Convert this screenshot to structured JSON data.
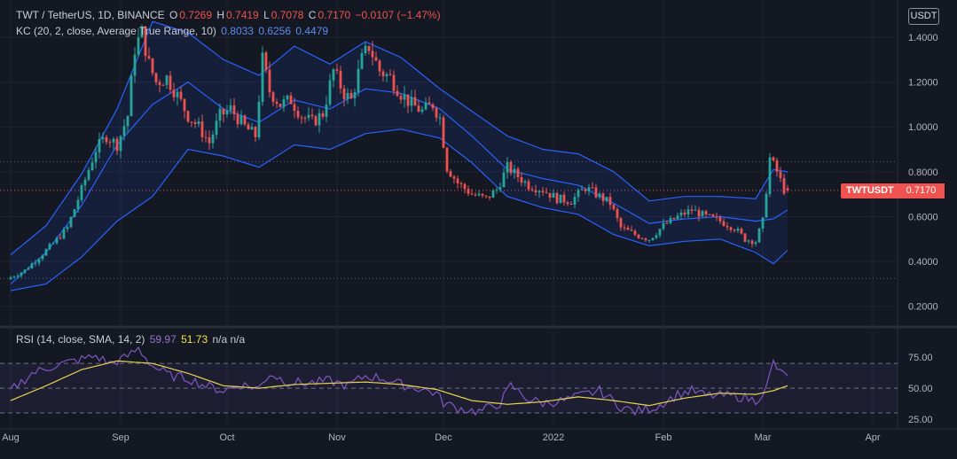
{
  "header": {
    "pair": "TWT / TetherUS, 1D, BINANCE",
    "o_label": "O",
    "o_val": "0.7269",
    "h_label": "H",
    "h_val": "0.7419",
    "l_label": "L",
    "l_val": "0.7078",
    "c_label": "C",
    "c_val": "0.7170",
    "change": "−0.0107 (−1.47%)"
  },
  "kc": {
    "label": "KC (20, 2, close, Average True Range, 10)",
    "upper": "0.8033",
    "basis": "0.6256",
    "lower": "0.4479"
  },
  "rsi": {
    "label": "RSI (14, close, SMA, 14, 2)",
    "value": "59.97",
    "sma": "51.73",
    "extra": "n/a  n/a"
  },
  "currency": "USDT",
  "symbol_tag": "TWTUSDT",
  "price_tag": "0.7170",
  "colors": {
    "up": "#26a69a",
    "down": "#ef5350",
    "band": "#2962ff",
    "rsi": "#7e57c2",
    "rsi_sma": "#e8d44d"
  },
  "chart_data": [
    {
      "type": "candlestick",
      "title": "TWT / TetherUS, 1D, BINANCE",
      "y_ticks": [
        "1.4000",
        "1.2000",
        "1.0000",
        "0.8000",
        "0.6000",
        "0.4000",
        "0.2000"
      ],
      "y_tick_values": [
        1.4,
        1.2,
        1.0,
        0.8,
        0.6,
        0.4,
        0.2
      ],
      "ylim": [
        0.12,
        1.55
      ],
      "x_ticks": [
        "Aug",
        "Sep",
        "Oct",
        "Nov",
        "Dec",
        "2022",
        "Feb",
        "Mar",
        "Apr"
      ],
      "x_tick_days": [
        0,
        31,
        61,
        92,
        122,
        153,
        184,
        212,
        243
      ],
      "x_range_days": [
        -3,
        250
      ],
      "last_price": 0.717,
      "reference_lines": [
        0.845,
        0.325
      ],
      "close_anchors": [
        [
          0,
          0.33
        ],
        [
          4,
          0.36
        ],
        [
          8,
          0.42
        ],
        [
          12,
          0.48
        ],
        [
          16,
          0.55
        ],
        [
          20,
          0.72
        ],
        [
          24,
          0.9
        ],
        [
          27,
          0.96
        ],
        [
          30,
          0.92
        ],
        [
          33,
          1.05
        ],
        [
          35,
          1.35
        ],
        [
          37,
          1.42
        ],
        [
          39,
          1.28
        ],
        [
          41,
          1.2
        ],
        [
          44,
          1.22
        ],
        [
          47,
          1.14
        ],
        [
          50,
          1.05
        ],
        [
          53,
          1.0
        ],
        [
          56,
          0.93
        ],
        [
          59,
          1.05
        ],
        [
          62,
          1.08
        ],
        [
          66,
          1.0
        ],
        [
          69,
          0.96
        ],
        [
          71,
          1.3
        ],
        [
          73,
          1.16
        ],
        [
          76,
          1.1
        ],
        [
          79,
          1.12
        ],
        [
          82,
          1.05
        ],
        [
          85,
          1.02
        ],
        [
          88,
          1.06
        ],
        [
          91,
          1.25
        ],
        [
          94,
          1.15
        ],
        [
          96,
          1.12
        ],
        [
          99,
          1.3
        ],
        [
          101,
          1.36
        ],
        [
          104,
          1.25
        ],
        [
          107,
          1.22
        ],
        [
          110,
          1.15
        ],
        [
          113,
          1.1
        ],
        [
          116,
          1.07
        ],
        [
          119,
          1.1
        ],
        [
          121,
          1.04
        ],
        [
          123,
          0.82
        ],
        [
          126,
          0.75
        ],
        [
          130,
          0.7
        ],
        [
          134,
          0.68
        ],
        [
          137,
          0.72
        ],
        [
          140,
          0.82
        ],
        [
          143,
          0.78
        ],
        [
          146,
          0.74
        ],
        [
          150,
          0.72
        ],
        [
          154,
          0.68
        ],
        [
          158,
          0.67
        ],
        [
          162,
          0.73
        ],
        [
          165,
          0.7
        ],
        [
          169,
          0.66
        ],
        [
          172,
          0.55
        ],
        [
          176,
          0.52
        ],
        [
          180,
          0.5
        ],
        [
          184,
          0.56
        ],
        [
          188,
          0.6
        ],
        [
          192,
          0.63
        ],
        [
          196,
          0.6
        ],
        [
          200,
          0.58
        ],
        [
          204,
          0.55
        ],
        [
          207,
          0.5
        ],
        [
          210,
          0.49
        ],
        [
          212,
          0.58
        ],
        [
          214,
          0.86
        ],
        [
          216,
          0.8
        ],
        [
          218,
          0.72
        ],
        [
          219,
          0.717
        ]
      ],
      "keltner_upper_anchors": [
        [
          0,
          0.43
        ],
        [
          10,
          0.56
        ],
        [
          20,
          0.79
        ],
        [
          30,
          1.08
        ],
        [
          40,
          1.47
        ],
        [
          50,
          1.42
        ],
        [
          60,
          1.3
        ],
        [
          70,
          1.23
        ],
        [
          80,
          1.36
        ],
        [
          90,
          1.28
        ],
        [
          100,
          1.38
        ],
        [
          110,
          1.31
        ],
        [
          121,
          1.17
        ],
        [
          130,
          1.07
        ],
        [
          140,
          0.96
        ],
        [
          150,
          0.9
        ],
        [
          160,
          0.88
        ],
        [
          170,
          0.8
        ],
        [
          180,
          0.67
        ],
        [
          190,
          0.69
        ],
        [
          200,
          0.69
        ],
        [
          210,
          0.68
        ],
        [
          215,
          0.81
        ],
        [
          219,
          0.8
        ]
      ],
      "keltner_basis_anchors": [
        [
          0,
          0.3
        ],
        [
          10,
          0.44
        ],
        [
          20,
          0.65
        ],
        [
          30,
          0.92
        ],
        [
          40,
          1.1
        ],
        [
          50,
          1.2
        ],
        [
          60,
          1.08
        ],
        [
          70,
          1.02
        ],
        [
          80,
          1.12
        ],
        [
          90,
          1.08
        ],
        [
          100,
          1.17
        ],
        [
          110,
          1.15
        ],
        [
          121,
          1.08
        ],
        [
          130,
          0.96
        ],
        [
          140,
          0.81
        ],
        [
          150,
          0.77
        ],
        [
          160,
          0.74
        ],
        [
          170,
          0.66
        ],
        [
          180,
          0.57
        ],
        [
          190,
          0.59
        ],
        [
          200,
          0.6
        ],
        [
          210,
          0.58
        ],
        [
          215,
          0.59
        ],
        [
          219,
          0.63
        ]
      ],
      "keltner_lower_anchors": [
        [
          0,
          0.27
        ],
        [
          10,
          0.3
        ],
        [
          20,
          0.42
        ],
        [
          30,
          0.58
        ],
        [
          40,
          0.69
        ],
        [
          50,
          0.9
        ],
        [
          60,
          0.87
        ],
        [
          70,
          0.82
        ],
        [
          80,
          0.92
        ],
        [
          90,
          0.9
        ],
        [
          100,
          0.97
        ],
        [
          110,
          0.99
        ],
        [
          121,
          0.95
        ],
        [
          130,
          0.84
        ],
        [
          140,
          0.69
        ],
        [
          150,
          0.64
        ],
        [
          160,
          0.61
        ],
        [
          170,
          0.52
        ],
        [
          180,
          0.47
        ],
        [
          190,
          0.49
        ],
        [
          200,
          0.5
        ],
        [
          210,
          0.44
        ],
        [
          215,
          0.39
        ],
        [
          219,
          0.45
        ]
      ]
    },
    {
      "type": "line",
      "title": "RSI (14, close, SMA, 14, 2)",
      "y_ticks": [
        "75.00",
        "50.00",
        "25.00"
      ],
      "y_tick_values": [
        75,
        50,
        25
      ],
      "ylim": [
        20,
        83
      ],
      "bands": [
        70,
        50,
        30
      ],
      "series": [
        {
          "name": "RSI",
          "points": [
            [
              0,
              48
            ],
            [
              6,
              62
            ],
            [
              12,
              68
            ],
            [
              18,
              72
            ],
            [
              24,
              76
            ],
            [
              28,
              70
            ],
            [
              32,
              74
            ],
            [
              36,
              82
            ],
            [
              40,
              68
            ],
            [
              45,
              60
            ],
            [
              50,
              58
            ],
            [
              55,
              52
            ],
            [
              60,
              48
            ],
            [
              65,
              53
            ],
            [
              70,
              50
            ],
            [
              73,
              62
            ],
            [
              78,
              55
            ],
            [
              84,
              54
            ],
            [
              90,
              56
            ],
            [
              95,
              52
            ],
            [
              100,
              60
            ],
            [
              105,
              58
            ],
            [
              110,
              53
            ],
            [
              115,
              50
            ],
            [
              120,
              46
            ],
            [
              122,
              38
            ],
            [
              126,
              34
            ],
            [
              132,
              31
            ],
            [
              138,
              38
            ],
            [
              141,
              52
            ],
            [
              146,
              41
            ],
            [
              150,
              38
            ],
            [
              156,
              40
            ],
            [
              162,
              45
            ],
            [
              166,
              48
            ],
            [
              172,
              35
            ],
            [
              176,
              31
            ],
            [
              182,
              35
            ],
            [
              188,
              45
            ],
            [
              192,
              48
            ],
            [
              196,
              44
            ],
            [
              202,
              44
            ],
            [
              206,
              43
            ],
            [
              210,
              40
            ],
            [
              213,
              50
            ],
            [
              215,
              71
            ],
            [
              217,
              62
            ],
            [
              219,
              60
            ]
          ]
        },
        {
          "name": "RSI-based MA",
          "points": [
            [
              0,
              40
            ],
            [
              10,
              52
            ],
            [
              20,
              65
            ],
            [
              30,
              72
            ],
            [
              40,
              70
            ],
            [
              50,
              62
            ],
            [
              60,
              52
            ],
            [
              70,
              50
            ],
            [
              80,
              53
            ],
            [
              90,
              54
            ],
            [
              100,
              55
            ],
            [
              110,
              53
            ],
            [
              120,
              49
            ],
            [
              130,
              40
            ],
            [
              140,
              37
            ],
            [
              150,
              39
            ],
            [
              160,
              43
            ],
            [
              170,
              40
            ],
            [
              180,
              36
            ],
            [
              190,
              42
            ],
            [
              200,
              46
            ],
            [
              210,
              45
            ],
            [
              215,
              48
            ],
            [
              219,
              52
            ]
          ]
        }
      ]
    }
  ]
}
